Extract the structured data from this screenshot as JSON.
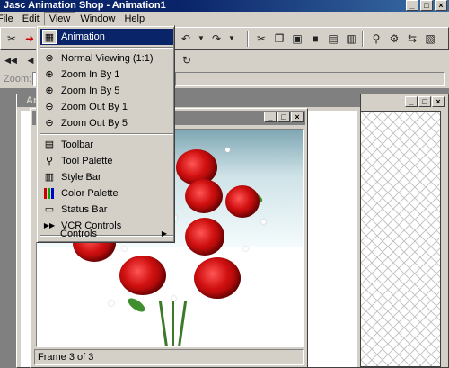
{
  "app": {
    "title": "Jasc Animation Shop - Animation1",
    "caption_buttons": [
      "_",
      "□",
      "×"
    ]
  },
  "menubar": {
    "items": [
      "File",
      "Edit",
      "View",
      "Window",
      "Help"
    ]
  },
  "toolbar3": {
    "zoom_label": "Zoom:"
  },
  "view_menu": {
    "items": [
      {
        "label": "Animation",
        "icon": "animation-icon",
        "highlighted": true
      },
      {
        "label": "Normal Viewing (1:1)",
        "icon": "normal-view-icon"
      },
      {
        "label": "Zoom In By 1",
        "icon": "zoom-in-icon"
      },
      {
        "label": "Zoom In By 5",
        "icon": "zoom-in-icon"
      },
      {
        "label": "Zoom Out By 1",
        "icon": "zoom-out-icon"
      },
      {
        "label": "Zoom Out By 5",
        "icon": "zoom-out-icon"
      },
      {
        "label": "Toolbar",
        "icon": "toolbar-icon"
      },
      {
        "label": "Tool Palette",
        "icon": "tool-palette-icon"
      },
      {
        "label": "Style Bar",
        "icon": "style-bar-icon"
      },
      {
        "label": "Color Palette",
        "icon": "color-palette-icon"
      },
      {
        "label": "Status Bar",
        "icon": "status-bar-icon"
      },
      {
        "label": "VCR Controls",
        "icon": "vcr-controls-icon"
      },
      {
        "label": "Controls",
        "icon": null,
        "submenu": true
      }
    ]
  },
  "child_window": {
    "title_fragment": "Ar",
    "status": "Frame 3 of 3"
  },
  "colors": {
    "titlebar": "#0a246a",
    "face": "#d4d0c8",
    "workspace": "#808080"
  }
}
